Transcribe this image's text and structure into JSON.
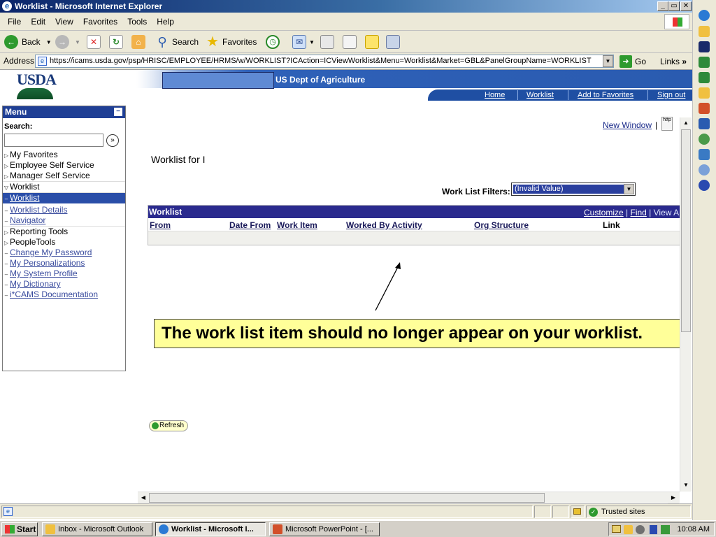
{
  "window": {
    "title": "Worklist - Microsoft Internet Explorer",
    "menus": [
      "File",
      "Edit",
      "View",
      "Favorites",
      "Tools",
      "Help"
    ]
  },
  "toolbar": {
    "back_label": "Back",
    "search_label": "Search",
    "favorites_label": "Favorites"
  },
  "address": {
    "label": "Address",
    "url": "https://icams.usda.gov/psp/HRISC/EMPLOYEE/HRMS/w/WORKLIST?ICAction=ICViewWorklist&Menu=Worklist&Market=GBL&PanelGroupName=WORKLIST",
    "go_label": "Go",
    "links_label": "Links"
  },
  "header": {
    "logo_text": "USDA",
    "dept": "US Dept of Agriculture",
    "nav": [
      "Home",
      "Worklist",
      "Add to Favorites",
      "Sign out"
    ]
  },
  "menu": {
    "title": "Menu",
    "search_label": "Search:",
    "items": [
      {
        "label": "My Favorites",
        "kind": "folder"
      },
      {
        "label": "Employee Self Service",
        "kind": "folder"
      },
      {
        "label": "Manager Self Service",
        "kind": "folder"
      },
      {
        "label": "Worklist",
        "kind": "open"
      },
      {
        "label": "Worklist",
        "kind": "selected"
      },
      {
        "label": "Worklist Details",
        "kind": "child"
      },
      {
        "label": "Navigator",
        "kind": "child"
      },
      {
        "label": "Reporting Tools",
        "kind": "folder"
      },
      {
        "label": "PeopleTools",
        "kind": "folder"
      },
      {
        "label": "Change My Password",
        "kind": "link"
      },
      {
        "label": "My Personalizations",
        "kind": "link"
      },
      {
        "label": "My System Profile",
        "kind": "link"
      },
      {
        "label": "My Dictionary",
        "kind": "link"
      },
      {
        "label": "i*CAMS Documentation",
        "kind": "link"
      }
    ]
  },
  "content": {
    "new_window": "New Window",
    "http_icon_text": "http",
    "worklist_title": "Worklist for I",
    "filter_label": "Work List Filters:",
    "filter_value": "(Invalid Value)",
    "grid_title": "Worklist",
    "grid_actions": {
      "customize": "Customize",
      "find": "Find",
      "view_all": "View A"
    },
    "columns": [
      "From",
      "Date From",
      "Work Item",
      "Worked By Activity",
      "Org Structure",
      "Link"
    ],
    "annotation": "The work list item should no longer appear on your worklist.",
    "refresh_label": "Refresh"
  },
  "status": {
    "zone": "Trusted sites"
  },
  "taskbar": {
    "start": "Start",
    "tasks": [
      "Inbox - Microsoft Outlook",
      "Worklist - Microsoft I...",
      "Microsoft PowerPoint - [..."
    ],
    "clock": "10:08 AM"
  }
}
